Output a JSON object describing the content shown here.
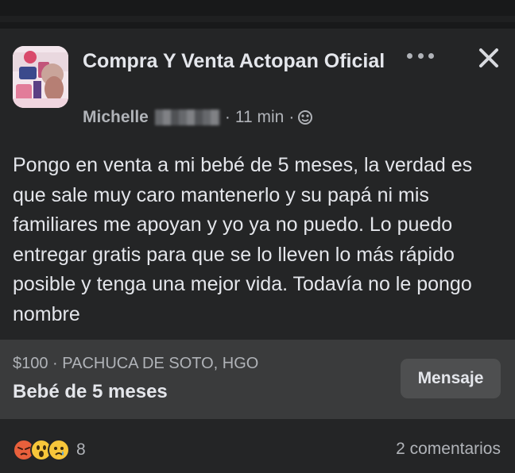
{
  "post": {
    "group_name": "Compra Y Venta Actopan Oficial",
    "author": "Michelle",
    "time": "11 min",
    "separator": "·",
    "privacy_icon": "globe-icon",
    "menu_icon": "more-options-icon",
    "close_icon": "close-icon",
    "text": "Pongo en venta a mi bebé de 5 meses, la verdad es que sale muy caro mantenerlo y su papá ni mis familiares me apoyan y yo ya no puedo. Lo puedo entregar gratis para que se lo lleven lo más rápido posible y tenga una mejor vida. Todavía no le pongo nombre"
  },
  "listing": {
    "price_location": "$100 · PACHUCA DE SOTO, HGO",
    "title": "Bebé de 5 meses",
    "message_button": "Mensaje"
  },
  "footer": {
    "reaction_icons": [
      "angry-reaction-icon",
      "wow-reaction-icon",
      "sad-reaction-icon"
    ],
    "reaction_count": "8",
    "comments": "2 comentarios"
  },
  "colors": {
    "background": "#18191a",
    "card": "#242526",
    "listing_band": "#3a3b3c",
    "primary_text": "#e4e6eb",
    "secondary_text": "#b0b3b8"
  }
}
